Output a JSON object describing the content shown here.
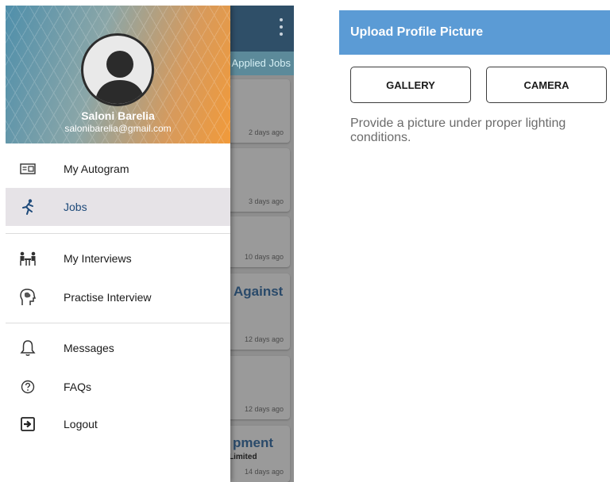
{
  "background_app": {
    "tab_label": "Applied Jobs",
    "cards": [
      {
        "ago": "2 days ago"
      },
      {
        "ago": "3 days ago"
      },
      {
        "ago": "10 days ago"
      },
      {
        "ago": "12 days ago"
      },
      {
        "ago": "12 days ago"
      },
      {
        "ago": "14 days ago"
      }
    ],
    "peek_texts": {
      "against": "Against",
      "pment": "pment",
      "limited": "Limited"
    }
  },
  "drawer": {
    "user": {
      "name": "Saloni Barelia",
      "email": "salonibarelia@gmail.com"
    },
    "items": [
      {
        "label": "My Autogram",
        "icon": "id-card-icon"
      },
      {
        "label": "Jobs",
        "icon": "running-person-icon",
        "active": true
      },
      {
        "label": "My Interviews",
        "icon": "interview-people-icon"
      },
      {
        "label": "Practise Interview",
        "icon": "brain-head-icon"
      },
      {
        "label": "Messages",
        "icon": "bell-icon"
      },
      {
        "label": "FAQs",
        "icon": "question-circle-icon"
      },
      {
        "label": "Logout",
        "icon": "logout-icon"
      }
    ]
  },
  "upload": {
    "title": "Upload Profile Picture",
    "gallery_label": "GALLERY",
    "camera_label": "CAMERA",
    "hint": "Provide a picture under proper lighting conditions."
  },
  "colors": {
    "upload_header": "#5b9bd5",
    "active_item_bg": "#e6e3e7",
    "active_item_text": "#1e4a7a",
    "header_gradient_start": "#4f8fab",
    "header_gradient_end": "#f19a3a"
  }
}
